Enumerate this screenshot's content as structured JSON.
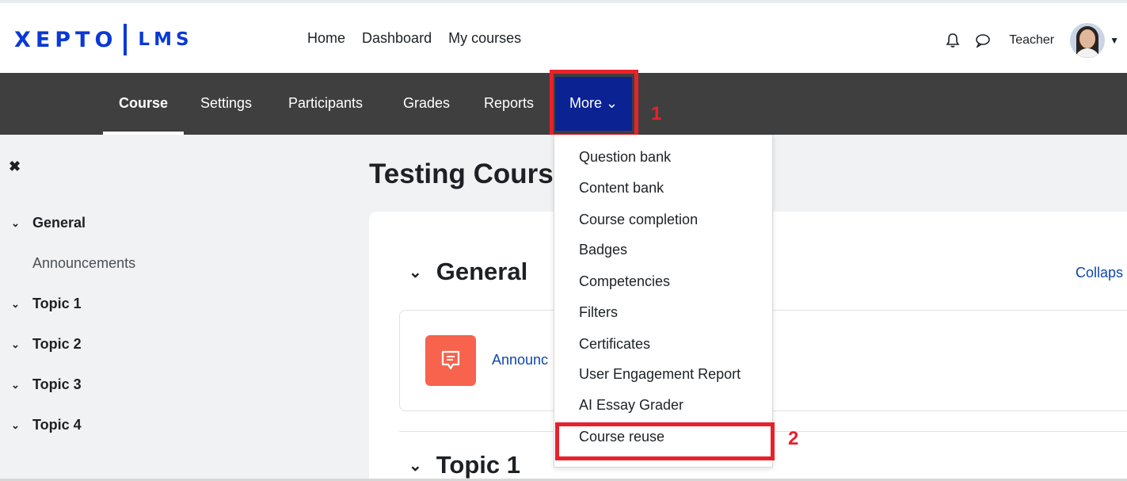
{
  "brand": {
    "name": "XEPTO",
    "product": "LMS",
    "color": "#0a39d6"
  },
  "primary_nav": [
    {
      "label": "Home"
    },
    {
      "label": "Dashboard"
    },
    {
      "label": "My courses"
    }
  ],
  "user": {
    "name": "Teacher",
    "icons": [
      "bell-icon",
      "chat-icon"
    ]
  },
  "secondary_nav": {
    "tabs": [
      {
        "label": "Course",
        "active": true
      },
      {
        "label": "Settings"
      },
      {
        "label": "Participants"
      },
      {
        "label": "Grades"
      },
      {
        "label": "Reports"
      }
    ],
    "more_label": "More",
    "more_bg": "#0a2292"
  },
  "annotations": {
    "step1": "1",
    "step2": "2",
    "highlight_color": "#e8212b"
  },
  "dropdown": {
    "items": [
      "Question bank",
      "Content bank",
      "Course completion",
      "Badges",
      "Competencies",
      "Filters",
      "Certificates",
      "User Engagement Report",
      "AI Essay Grader",
      "Course reuse"
    ]
  },
  "drawer": {
    "items": [
      {
        "label": "General",
        "type": "section"
      },
      {
        "label": "Announcements",
        "type": "activity"
      },
      {
        "label": "Topic 1",
        "type": "section"
      },
      {
        "label": "Topic 2",
        "type": "section"
      },
      {
        "label": "Topic 3",
        "type": "section"
      },
      {
        "label": "Topic 4",
        "type": "section"
      }
    ]
  },
  "main": {
    "course_title": "Testing Cours",
    "section1": "General",
    "collapse_label": "Collaps",
    "activity_label": "Announc",
    "activity_icon_color": "#f7634d",
    "section2": "Topic 1"
  }
}
